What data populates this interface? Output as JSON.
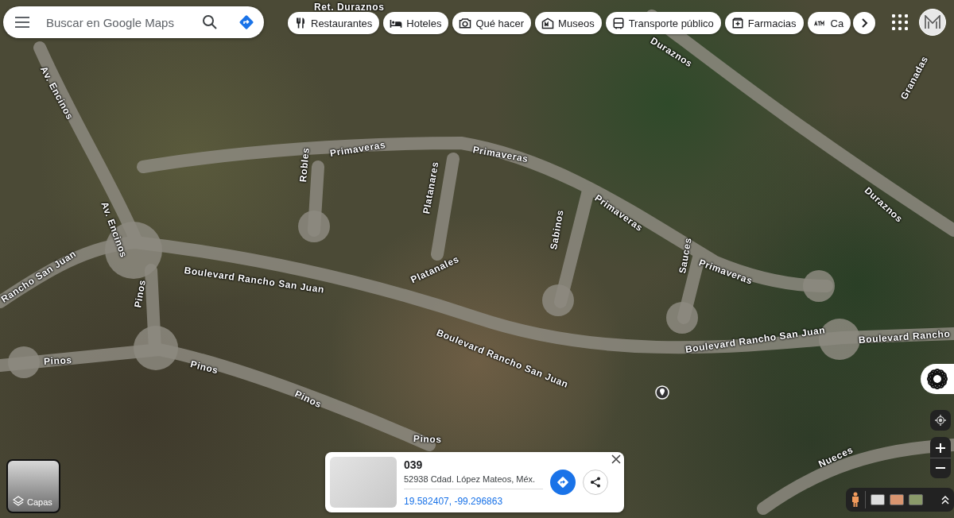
{
  "search": {
    "placeholder": "Buscar en Google Maps"
  },
  "chips": [
    {
      "label": "Restaurantes",
      "kind": "restaurant"
    },
    {
      "label": "Hoteles",
      "kind": "hotel"
    },
    {
      "label": "Qué hacer",
      "kind": "camera"
    },
    {
      "label": "Museos",
      "kind": "museum"
    },
    {
      "label": "Transporte público",
      "kind": "transit"
    },
    {
      "label": "Farmacias",
      "kind": "pharmacy"
    },
    {
      "label": "Ca",
      "kind": "atm"
    }
  ],
  "map_labels": [
    {
      "text": "Ret. Duraznos"
    },
    {
      "text": "Av. Encinos"
    },
    {
      "text": "Duraznos"
    },
    {
      "text": "Granadas"
    },
    {
      "text": "Duraznos"
    },
    {
      "text": "Primaveras"
    },
    {
      "text": "Primaveras"
    },
    {
      "text": "Primaveras"
    },
    {
      "text": "Primaveras"
    },
    {
      "text": "Av. Encinos"
    },
    {
      "text": "Robles"
    },
    {
      "text": "Platanares"
    },
    {
      "text": "Platanales"
    },
    {
      "text": "Sabinos"
    },
    {
      "text": "Sauces"
    },
    {
      "text": "Rancho San Juan"
    },
    {
      "text": "Boulevard Rancho San Juan"
    },
    {
      "text": "Boulevard Rancho San Juan"
    },
    {
      "text": "Boulevard Rancho San Juan"
    },
    {
      "text": "Boulevard Rancho"
    },
    {
      "text": "Pinos"
    },
    {
      "text": "Pinos"
    },
    {
      "text": "Pinos"
    },
    {
      "text": "Pinos"
    },
    {
      "text": "Pinos"
    },
    {
      "text": "Nueces"
    }
  ],
  "layers_button": {
    "label": "Capas"
  },
  "place_card": {
    "title": "039",
    "address": "52938 Cdad. López Mateos, Méx.",
    "coordinates": "19.582407, -99.296863"
  }
}
